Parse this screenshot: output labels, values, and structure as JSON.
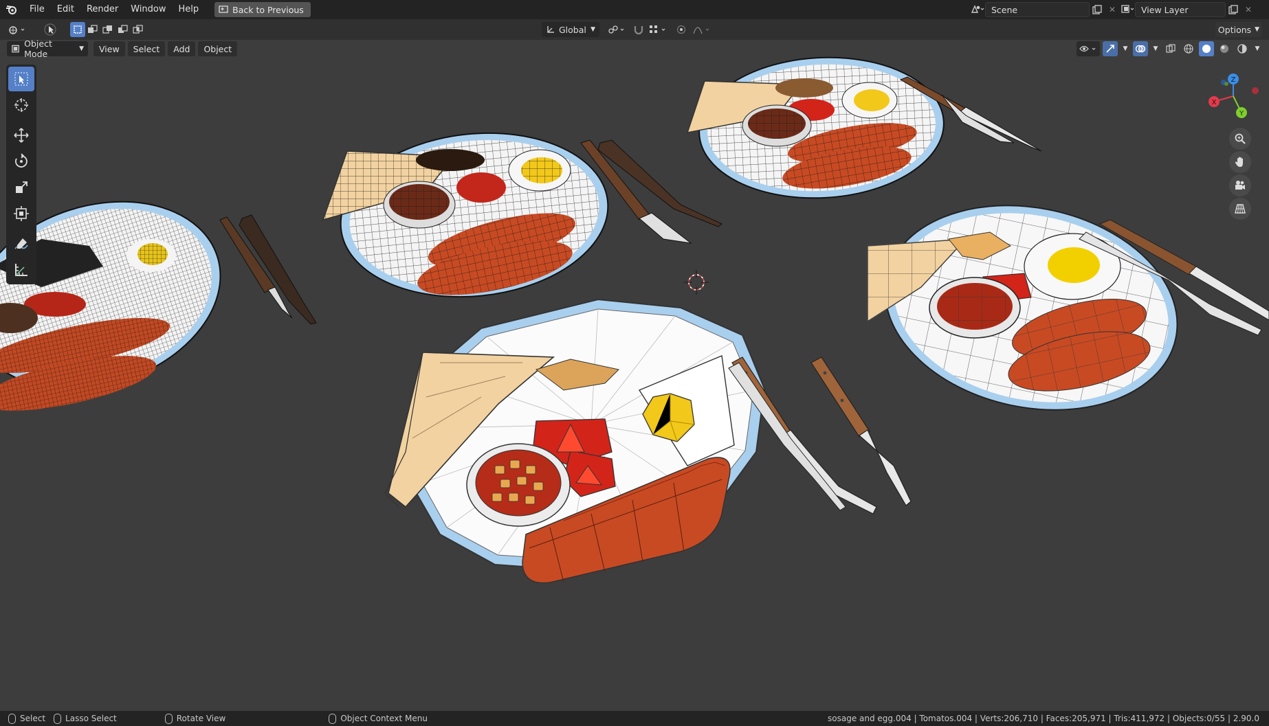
{
  "topbar": {
    "menus": [
      "File",
      "Edit",
      "Render",
      "Window",
      "Help"
    ],
    "back_button": "Back to Previous",
    "scene_name": "Scene",
    "view_layer_name": "View Layer"
  },
  "header": {
    "orientation": "Global",
    "options_label": "Options"
  },
  "viewport_header": {
    "mode": "Object Mode",
    "menus": [
      "View",
      "Select",
      "Add",
      "Object"
    ]
  },
  "toolbar": {
    "tools": [
      "select-box",
      "cursor",
      "move",
      "rotate",
      "scale",
      "transform",
      "annotate",
      "measure"
    ],
    "active": "select-box"
  },
  "gizmo": {
    "x_label": "X",
    "y_label": "Y",
    "z_label": "Z",
    "x_color": "#e33b4b",
    "y_color": "#7fcf2d",
    "z_color": "#3b8ee8"
  },
  "statusbar": {
    "select": "Select",
    "lasso_select": "Lasso Select",
    "rotate_view": "Rotate View",
    "context_menu": "Object Context Menu",
    "stats": "sosage and egg.004 | Tomatos.004 | Verts:206,710 | Faces:205,971 | Tris:411,972 | Objects:0/55 | 2.90.0"
  },
  "colors": {
    "accent": "#5580c8",
    "viewport_bg": "#3d3d3d",
    "sausage": "#c84a23",
    "toast": "#f2d2a0",
    "yolk": "#f2c81a",
    "tomato": "#d3241a",
    "plate_rim": "#a9cfee"
  }
}
